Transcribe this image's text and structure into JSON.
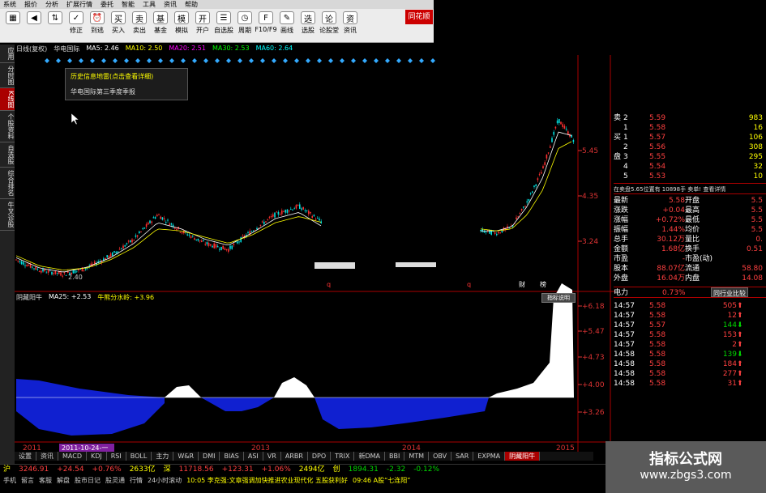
{
  "menu": [
    "系统",
    "报价",
    "分析",
    "扩展行情",
    "委托",
    "智能",
    "工具",
    "资讯",
    "帮助"
  ],
  "toolbar": [
    {
      "label": "",
      "icon": "grid-icon"
    },
    {
      "label": "",
      "icon": "back-arrow-icon"
    },
    {
      "label": "",
      "icon": "up-down-arrows-icon"
    },
    {
      "label": "修正",
      "icon": "correct-icon"
    },
    {
      "label": "到逃",
      "icon": "clock-icon"
    },
    {
      "label": "买入",
      "icon": "buy-icon"
    },
    {
      "label": "卖出",
      "icon": "sell-icon"
    },
    {
      "label": "基金",
      "icon": "fund-icon"
    },
    {
      "label": "模拟",
      "icon": "simulate-icon"
    },
    {
      "label": "开户",
      "icon": "account-icon"
    },
    {
      "label": "自选股",
      "icon": "watchlist-icon"
    },
    {
      "label": "周期",
      "icon": "period-icon"
    },
    {
      "label": "F10/F9",
      "icon": "f10-icon"
    },
    {
      "label": "画线",
      "icon": "drawline-icon"
    },
    {
      "label": "选股",
      "icon": "select-icon"
    },
    {
      "label": "论股堂",
      "icon": "forum-icon"
    },
    {
      "label": "资讯",
      "icon": "news-icon"
    }
  ],
  "logo": "同花顺",
  "left_tabs": [
    "应用",
    "分时图",
    "K线图",
    "个股资料",
    "自选股",
    "综合排名",
    "牛叉诊股"
  ],
  "active_left_tab": 2,
  "kline_header": {
    "period": "日线(复权)",
    "stock": "华电国际",
    "ma5": "MA5: 2.46",
    "ma10": "MA10: 2.50",
    "ma20": "MA20: 2.51",
    "ma30": "MA30: 2.53",
    "ma60": "MA60: 2.64"
  },
  "popup": {
    "title": "历史信息地雷(点击查看详细)",
    "body": "华电国际第三季度季报"
  },
  "price_axis": [
    "5.45",
    "4.35",
    "3.24"
  ],
  "low_label": "2.40",
  "indicator_header": {
    "name": "阴藏阳牛",
    "ma25": "MA25: +2.53",
    "water": "牛熊分水岭: +3.96"
  },
  "indicator_axis": [
    "+6.18",
    "+5.47",
    "+4.73",
    "+4.00",
    "+3.26"
  ],
  "explain_button": "指标说明",
  "years": [
    "2011",
    "2013",
    "2014",
    "2015"
  ],
  "cursor_date": "2011-10-24-一",
  "bottom_tabs": [
    "设置",
    "资讯",
    "MACD",
    "KDJ",
    "RSI",
    "BOLL",
    "主力",
    "W&R",
    "DMI",
    "BIAS",
    "ASI",
    "VR",
    "ARBR",
    "DPO",
    "TRIX",
    "新DMA",
    "BBI",
    "MTM",
    "OBV",
    "SAR",
    "EXPMA",
    "阴藏阳牛"
  ],
  "active_bottom_tab": 21,
  "status": {
    "sh_label": "沪",
    "sh_value": "3246.91",
    "sh_change": "+24.54",
    "sh_pct": "+0.76%",
    "sh_amount": "2633亿",
    "sz_label": "深",
    "sz_value": "11718.56",
    "sz_change": "+123.31",
    "sz_pct": "+1.06%",
    "sz_amount": "2494亿",
    "cy_label": "创",
    "cy_value": "1894.31",
    "cy_change": "-2.32",
    "cy_pct": "-0.12%"
  },
  "footer": {
    "items": [
      "手机",
      "留言",
      "客服",
      "解盘",
      "股市日记",
      "股灵通",
      "行情",
      "24小时滚动"
    ],
    "news": "10:05 李克强:文章强调加快推进农业现代化 五股获利好",
    "news2": "09:46 A股“七连阳”"
  },
  "order_book": {
    "sell": [
      {
        "label": "卖",
        "level": "2",
        "price": "5.59",
        "vol": "983"
      },
      {
        "label": "",
        "level": "1",
        "price": "5.58",
        "vol": "16"
      }
    ],
    "buy": [
      {
        "label": "买",
        "level": "1",
        "price": "5.57",
        "vol": "106"
      },
      {
        "label": "",
        "level": "2",
        "price": "5.56",
        "vol": "308"
      },
      {
        "label": "盘",
        "level": "3",
        "price": "5.55",
        "vol": "295"
      },
      {
        "label": "",
        "level": "4",
        "price": "5.54",
        "vol": "32"
      },
      {
        "label": "",
        "level": "5",
        "price": "5.53",
        "vol": "10"
      }
    ],
    "note": "在卖盘5.65位置有 10898手 卖单! 查看详情"
  },
  "quote": [
    {
      "k1": "最新",
      "v1": "5.58",
      "k2": "开盘",
      "v2": "5.5"
    },
    {
      "k1": "涨跌",
      "v1": "+0.04",
      "k2": "最高",
      "v2": "5.5"
    },
    {
      "k1": "涨幅",
      "v1": "+0.72%",
      "k2": "最低",
      "v2": "5.5"
    },
    {
      "k1": "振幅",
      "v1": "1.44%",
      "k2": "均价",
      "v2": "5.5"
    },
    {
      "k1": "总手",
      "v1": "30.12万",
      "k2": "量比",
      "v2": "0."
    },
    {
      "k1": "金额",
      "v1": "1.68亿",
      "k2": "换手",
      "v2": "0.51"
    },
    {
      "k1": "市盈",
      "v1": "-",
      "k2": "市盈(动)",
      "v2": ""
    },
    {
      "k1": "股本",
      "v1": "88.07亿",
      "k2": "流通",
      "v2": "58.80"
    },
    {
      "k1": "外盘",
      "v1": "16.04万",
      "k2": "内盘",
      "v2": "14.08"
    }
  ],
  "industry": {
    "name": "电力",
    "pct": "0.73%",
    "button": "同行业比较"
  },
  "ticks": [
    {
      "time": "14:57",
      "price": "5.58",
      "vol": "505",
      "dir": "up"
    },
    {
      "time": "14:57",
      "price": "5.58",
      "vol": "12",
      "dir": "up"
    },
    {
      "time": "14:57",
      "price": "5.57",
      "vol": "144",
      "dir": "down"
    },
    {
      "time": "14:57",
      "price": "5.58",
      "vol": "153",
      "dir": "up"
    },
    {
      "time": "14:57",
      "price": "5.58",
      "vol": "2",
      "dir": "up"
    },
    {
      "time": "14:58",
      "price": "5.58",
      "vol": "139",
      "dir": "down"
    },
    {
      "time": "14:58",
      "price": "5.58",
      "vol": "184",
      "dir": "up"
    },
    {
      "time": "14:58",
      "price": "5.58",
      "vol": "277",
      "dir": "up"
    },
    {
      "time": "14:58",
      "price": "5.58",
      "vol": "31",
      "dir": "up"
    }
  ],
  "watermark": {
    "line1": "指标公式网",
    "line2": "www.zbgs3.com"
  }
}
